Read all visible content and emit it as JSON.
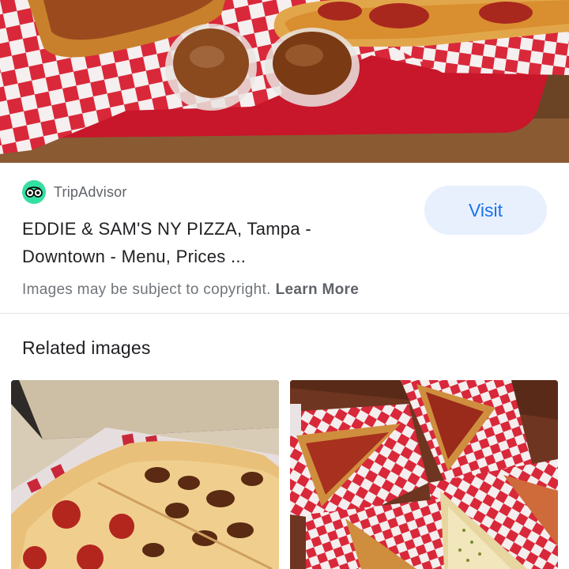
{
  "result": {
    "source_name": "TripAdvisor",
    "source_icon": "tripadvisor-owl-icon",
    "source_color": "#34e0a1",
    "title_line1": "EDDIE & SAM'S NY PIZZA, Tampa -",
    "title_line2": "Downtown - Menu, Prices ...",
    "visit_label": "Visit"
  },
  "copyright": {
    "text": "Images may be subject to copyright.",
    "learn_more": "Learn More"
  },
  "related": {
    "heading": "Related images",
    "items": [
      {
        "name": "related-image-pizza-box"
      },
      {
        "name": "related-image-pizza-slices"
      }
    ]
  },
  "colors": {
    "accent": "#1a73e8",
    "button_bg": "#e8f0fe",
    "checker_red": "#d9283a"
  }
}
